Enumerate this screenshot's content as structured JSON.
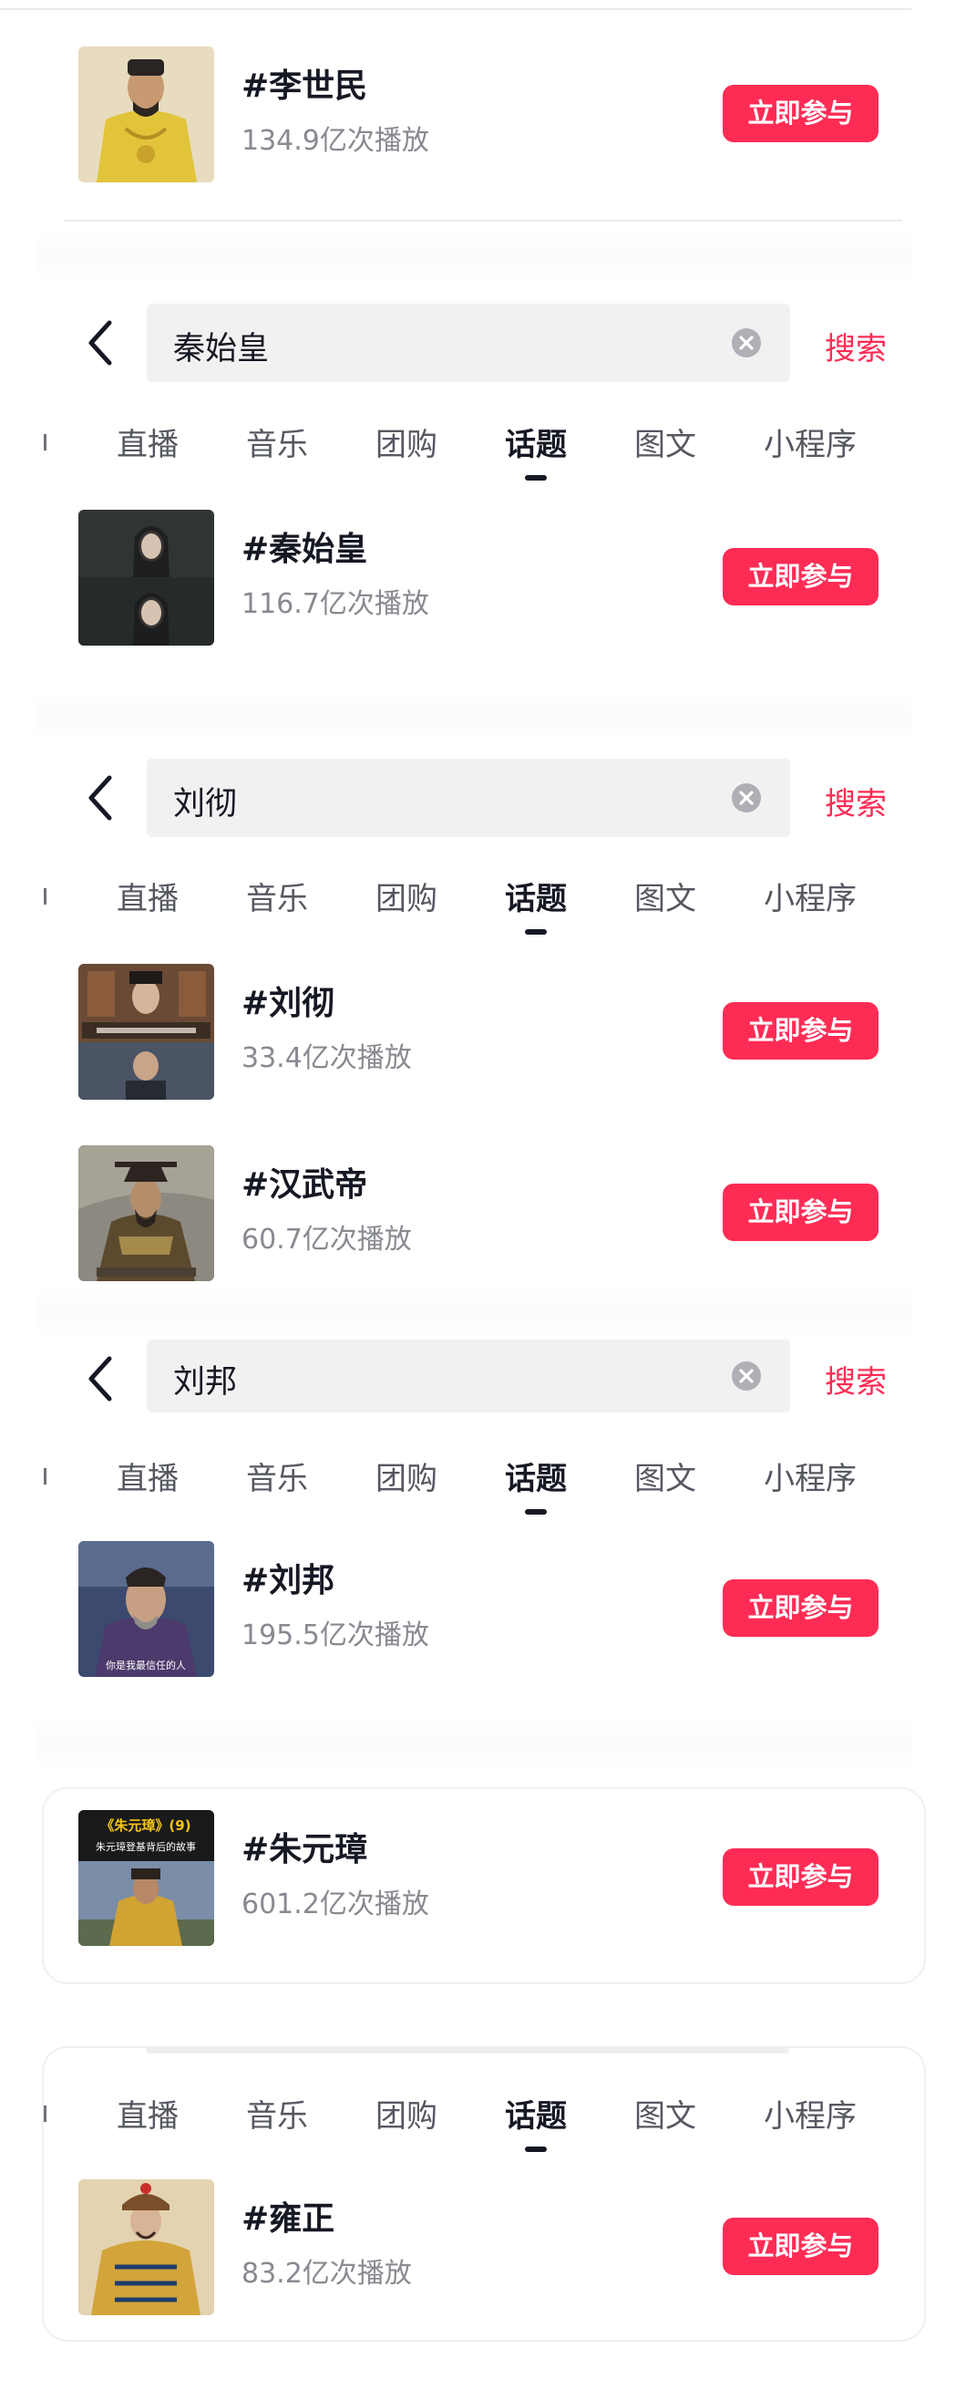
{
  "topics": [
    {
      "title": "#李世民",
      "plays": "134.9亿次播放",
      "button": "立即参与",
      "thumb_icon": "emperor-portrait-yellow"
    },
    {
      "title": "#秦始皇",
      "plays": "116.7亿次播放",
      "button": "立即参与",
      "thumb_icon": "drama-still-dark"
    },
    {
      "title": "#刘彻",
      "plays": "33.4亿次播放",
      "button": "立即参与",
      "thumb_icon": "drama-still-palace"
    },
    {
      "title": "#汉武帝",
      "plays": "60.7亿次播放",
      "button": "立即参与",
      "thumb_icon": "emperor-armor-painting"
    },
    {
      "title": "#刘邦",
      "plays": "195.5亿次播放",
      "button": "立即参与",
      "thumb_icon": "drama-still-purple",
      "thumb_caption": "你是我最信任的人"
    },
    {
      "title": "#朱元璋",
      "plays": "601.2亿次播放",
      "button": "立即参与",
      "thumb_icon": "drama-poster-yellow",
      "thumb_caption": "《朱元璋》(9)",
      "thumb_subcaption": "朱元璋登基背后的故事"
    },
    {
      "title": "#雍正",
      "plays": "83.2亿次播放",
      "button": "立即参与",
      "thumb_icon": "emperor-portrait-qing"
    }
  ],
  "searches": [
    {
      "query": "秦始皇",
      "action": "搜索"
    },
    {
      "query": "刘彻",
      "action": "搜索"
    },
    {
      "query": "刘邦",
      "action": "搜索"
    }
  ],
  "tabs": [
    "直播",
    "音乐",
    "团购",
    "话题",
    "图文",
    "小程序"
  ],
  "active_tab": "话题",
  "colors": {
    "accent": "#fe2c55",
    "text": "#161823",
    "muted": "#888a91",
    "field": "#f1f1f2"
  }
}
